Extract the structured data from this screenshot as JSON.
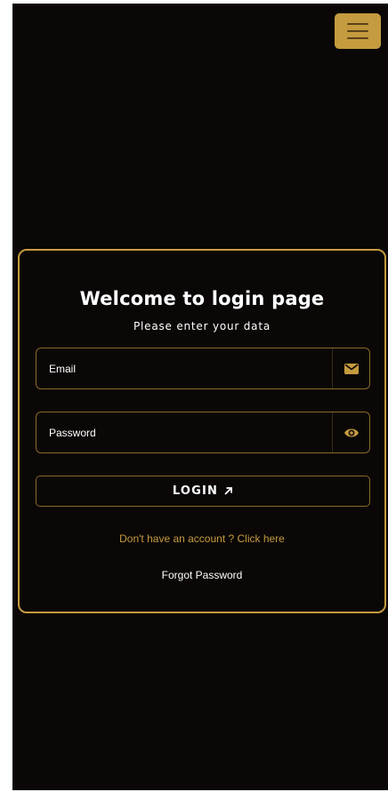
{
  "header": {
    "menu_icon": "hamburger-menu-icon"
  },
  "login": {
    "title": "Welcome to login page",
    "subtitle": "Please enter your data",
    "email_label": "Email",
    "email_icon": "envelope-icon",
    "password_label": "Password",
    "password_icon": "eye-icon",
    "login_button_label": "LOGIN",
    "login_button_icon": "arrow-up-right-icon",
    "signup_link": "Don't have an account ? Click here",
    "forgot_password_link": "Forgot Password"
  },
  "colors": {
    "background": "#0a0706",
    "accent": "#c59b3f",
    "text": "#ffffff"
  }
}
